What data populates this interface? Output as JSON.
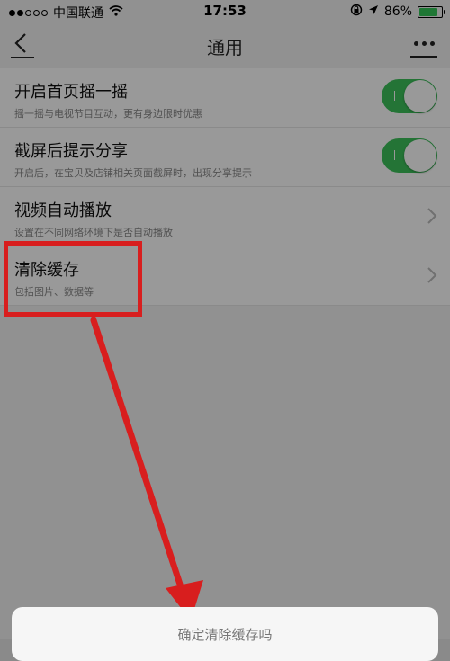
{
  "status_bar": {
    "carrier": "中国联通",
    "time": "17:53",
    "battery": "86%",
    "battery_level": 0.86,
    "battery_color": "#34c759"
  },
  "nav": {
    "title": "通用",
    "back_icon": "chevron-left-icon",
    "more_icon": "more-icon"
  },
  "settings": [
    {
      "title": "开启首页摇一摇",
      "subtitle": "摇一摇与电视节目互动，更有身边限时优惠",
      "control": "toggle",
      "on": true
    },
    {
      "title": "截屏后提示分享",
      "subtitle": "开启后，在宝贝及店铺相关页面截屏时，出现分享提示",
      "control": "toggle",
      "on": true
    },
    {
      "title": "视频自动播放",
      "subtitle": "设置在不同网络环境下是否自动播放",
      "control": "chevron"
    },
    {
      "title": "清除缓存",
      "subtitle": "包括图片、数据等",
      "control": "chevron"
    }
  ],
  "sheet": {
    "message": "确定清除缓存吗"
  },
  "colors": {
    "toggle_on": "#3cc15a",
    "annotation": "#d81e1e"
  }
}
